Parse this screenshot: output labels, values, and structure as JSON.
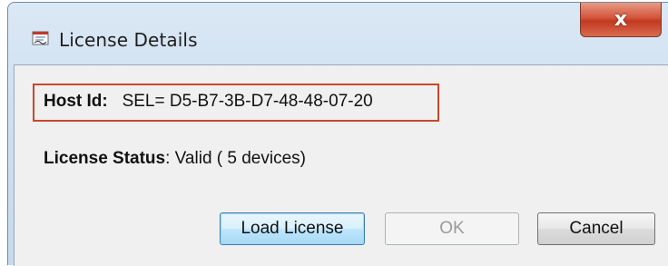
{
  "window": {
    "title": "License Details",
    "close_glyph": "x",
    "icon": "license-document-icon"
  },
  "host": {
    "label": "Host Id:",
    "value": "SEL= D5-B7-3B-D7-48-48-07-20"
  },
  "status": {
    "label": "License Status",
    "value": ": Valid ( 5 devices)"
  },
  "buttons": {
    "load": "Load License",
    "ok": "OK",
    "cancel": "Cancel"
  },
  "colors": {
    "highlight_box": "#c8492b",
    "close_button": "#d2543b",
    "default_button_border": "#3c7fb1"
  }
}
